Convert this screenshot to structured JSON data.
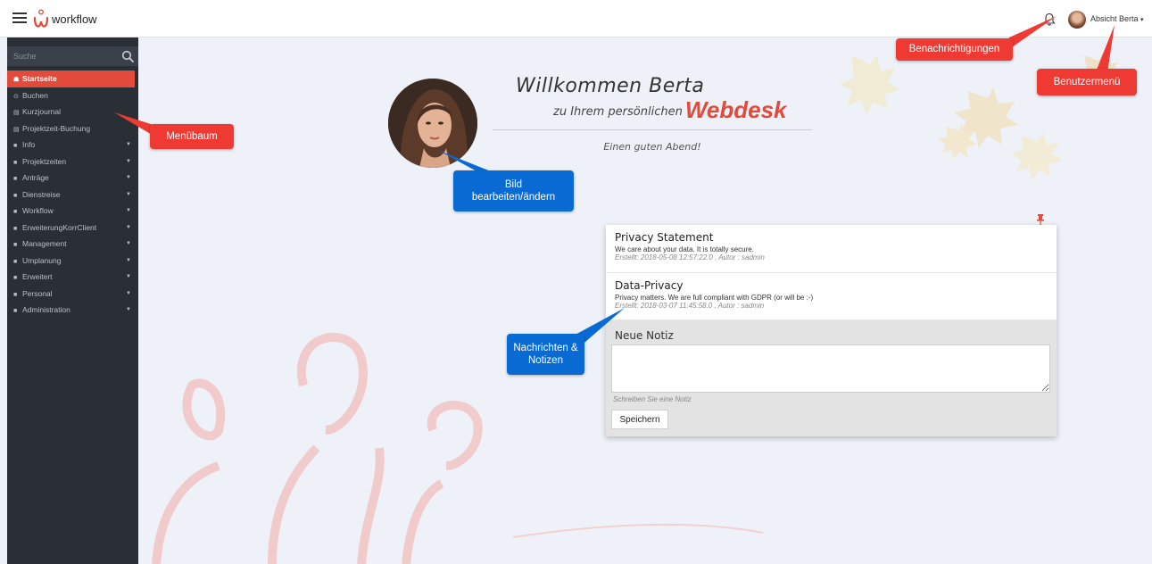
{
  "app": {
    "brand": "workflow"
  },
  "header": {
    "user_menu_label": "Absicht Berta",
    "user_menu_caret": "▾"
  },
  "sidebar": {
    "search_placeholder": "Suche",
    "items": [
      {
        "label": "Startseite",
        "icon": "home-icon",
        "glyph": "☗",
        "active": true,
        "expandable": false
      },
      {
        "label": "Buchen",
        "icon": "clock-icon",
        "glyph": "⊙",
        "active": false,
        "expandable": false
      },
      {
        "label": "Kurzjournal",
        "icon": "table-icon",
        "glyph": "▤",
        "active": false,
        "expandable": false
      },
      {
        "label": "Projektzeit-Buchung",
        "icon": "table-icon",
        "glyph": "▤",
        "active": false,
        "expandable": false
      },
      {
        "label": "Info",
        "icon": "folder-icon",
        "glyph": "■",
        "active": false,
        "expandable": true
      },
      {
        "label": "Projektzeiten",
        "icon": "folder-icon",
        "glyph": "■",
        "active": false,
        "expandable": true
      },
      {
        "label": "Anträge",
        "icon": "folder-icon",
        "glyph": "■",
        "active": false,
        "expandable": true
      },
      {
        "label": "Dienstreise",
        "icon": "folder-icon",
        "glyph": "■",
        "active": false,
        "expandable": true
      },
      {
        "label": "Workflow",
        "icon": "folder-icon",
        "glyph": "■",
        "active": false,
        "expandable": true
      },
      {
        "label": "ErweiterungKorrClient",
        "icon": "folder-icon",
        "glyph": "■",
        "active": false,
        "expandable": true
      },
      {
        "label": "Management",
        "icon": "folder-icon",
        "glyph": "■",
        "active": false,
        "expandable": true
      },
      {
        "label": "Umplanung",
        "icon": "folder-icon",
        "glyph": "■",
        "active": false,
        "expandable": true
      },
      {
        "label": "Erweitert",
        "icon": "folder-icon",
        "glyph": "■",
        "active": false,
        "expandable": true
      },
      {
        "label": "Personal",
        "icon": "folder-icon",
        "glyph": "■",
        "active": false,
        "expandable": true
      },
      {
        "label": "Administration",
        "icon": "folder-icon",
        "glyph": "■",
        "active": false,
        "expandable": true
      }
    ]
  },
  "welcome": {
    "title": "Willkommen Berta",
    "subtitle": "zu Ihrem persönlichen",
    "product": "Webdesk",
    "greeting": "Einen guten Abend!"
  },
  "messages": [
    {
      "title": "Privacy Statement",
      "body": "We care about your data. It is totally secure.",
      "meta": "Erstellt:   2018-05-08 12:57:22.0 , Autor : sadmin"
    },
    {
      "title": "Data-Privacy",
      "body": "Privacy matters. We are full compliant with GDPR (or will be :-)",
      "meta": "Erstellt:   2018-03-07 11:45:58.0 , Autor : sadmin"
    }
  ],
  "note": {
    "title": "Neue Notiz",
    "hint": "Schreiben Sie eine Notiz",
    "save_label": "Speichern"
  },
  "callouts": {
    "notifications": "Benachrichtigungen",
    "user_menu": "Benutzermenü",
    "menu_tree": "Menübaum",
    "edit_picture": "Bild\nbearbeiten/ändern",
    "messages_notes": "Nachrichten &\nNotizen"
  },
  "colors": {
    "accent": "#e24a3b",
    "sidebar": "#2a2f36",
    "callout_red": "#ee3a33",
    "callout_blue": "#0a6ad4"
  }
}
